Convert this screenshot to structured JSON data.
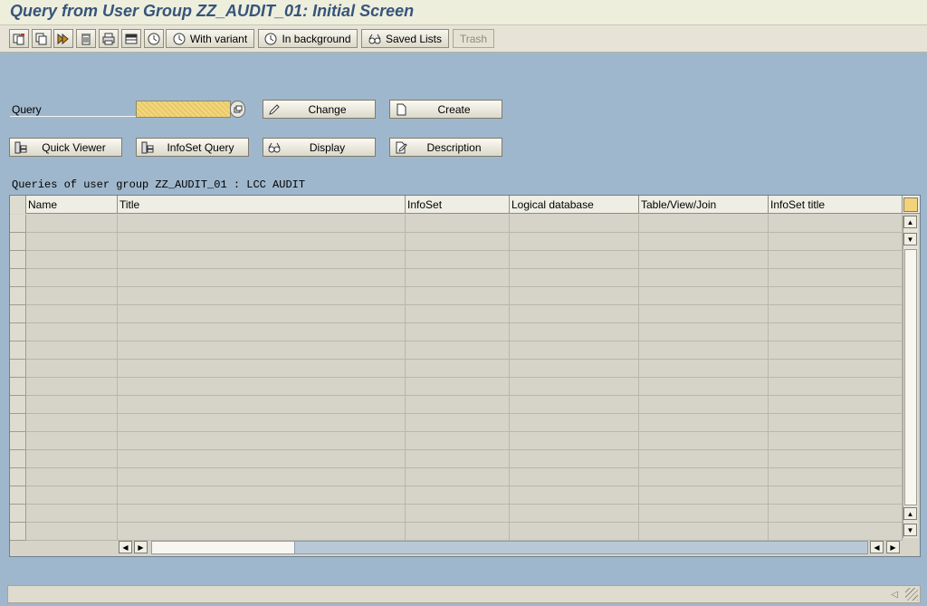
{
  "window": {
    "title": "Query from User Group ZZ_AUDIT_01: Initial Screen"
  },
  "toolbar": {
    "icons": [
      "new-document-icon",
      "copy-icon",
      "execute-icon",
      "trash-icon",
      "print-icon",
      "layout-icon",
      "execute-clock-icon"
    ],
    "with_variant": "With variant",
    "in_background": "In background",
    "saved_lists": "Saved Lists",
    "trash": "Trash"
  },
  "form": {
    "query_label": "Query",
    "query_value": "",
    "change": "Change",
    "create": "Create",
    "quick_viewer": "Quick Viewer",
    "infoset_query": "InfoSet Query",
    "display": "Display",
    "description": "Description"
  },
  "grid": {
    "caption": "Queries of user group ZZ_AUDIT_01 : LCC AUDIT",
    "columns": [
      "Name",
      "Title",
      "InfoSet",
      "Logical database",
      "Table/View/Join",
      "InfoSet title"
    ],
    "row_count": 18
  },
  "colors": {
    "background": "#9fb7cc",
    "title": "#36557a",
    "input_highlight": "#f3d77e"
  }
}
